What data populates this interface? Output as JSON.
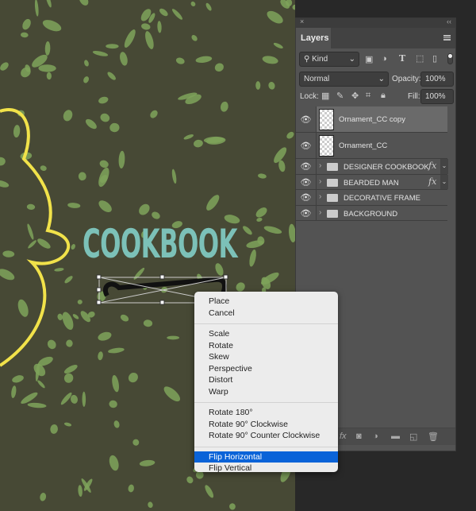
{
  "canvas": {
    "title_text": "COOKBOOK",
    "colors": {
      "background": "#474935",
      "leaves": "#7fa35a",
      "title": "#7cc1b8",
      "figure": "#f1e24a"
    }
  },
  "panel": {
    "close_label": "×",
    "collapse_label": "‹‹",
    "tab": "Layers",
    "filter": {
      "kind": "Kind",
      "icons": [
        "image-filter-icon",
        "adjustment-filter-icon",
        "type-filter-icon",
        "shape-filter-icon",
        "smart-object-filter-icon"
      ]
    },
    "blend_mode": "Normal",
    "opacity_label": "Opacity:",
    "opacity": "100%",
    "lock_label": "Lock:",
    "fill_label": "Fill:",
    "fill": "100%",
    "layers": [
      {
        "name": "Ornament_CC copy",
        "type": "smart-object",
        "selected": true,
        "visible": true
      },
      {
        "name": "Ornament_CC",
        "type": "smart-object",
        "selected": false,
        "visible": true
      },
      {
        "name": "DESIGNER COOKBOOK",
        "type": "group",
        "fx": "fx",
        "visible": true
      },
      {
        "name": "BEARDED MAN",
        "type": "group",
        "fx": "fx",
        "visible": true
      },
      {
        "name": "DECORATIVE FRAME",
        "type": "group",
        "visible": true
      },
      {
        "name": "BACKGROUND",
        "type": "group",
        "visible": true
      }
    ],
    "bottom_fx": "fx"
  },
  "context_menu": {
    "groups": [
      [
        "Place",
        "Cancel"
      ],
      [
        "Scale",
        "Rotate",
        "Skew",
        "Perspective",
        "Distort",
        "Warp"
      ],
      [
        "Rotate 180°",
        "Rotate 90° Clockwise",
        "Rotate 90° Counter Clockwise"
      ],
      [
        "Flip Horizontal",
        "Flip Vertical"
      ]
    ],
    "highlighted": "Flip Horizontal"
  }
}
